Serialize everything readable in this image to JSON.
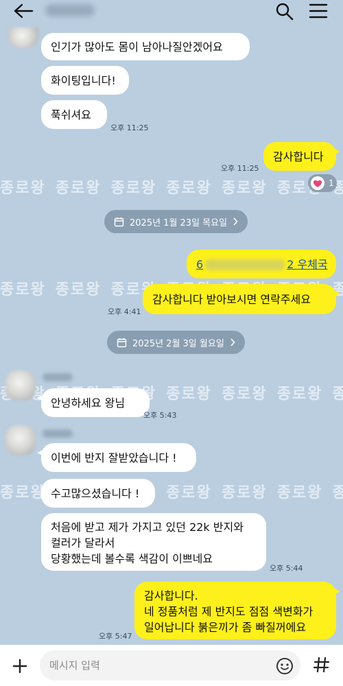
{
  "watermark": {
    "text": "종로왕",
    "repeat": [
      "종로왕",
      "종로왕",
      "종로왕",
      "종로왕",
      "종로왕",
      "종로왕",
      "종로왕"
    ]
  },
  "reaction": {
    "count": "1"
  },
  "messages": [
    {
      "text": "인기가 많아도 몸이 남아나질안겠어요"
    },
    {
      "text": "화이팅입니다!"
    },
    {
      "text": "푹쉬셔요",
      "time": "오후 11:25"
    },
    {
      "text": "감사합니다",
      "time": "오후 11:25"
    },
    {
      "link_prefix": "6",
      "link_suffix": "2 우체국"
    },
    {
      "text": "감사합니다 받아보시면 연락주세요",
      "time": "오후 4:41"
    },
    {
      "text": "안녕하세요 왕님",
      "time": "오후 5:43"
    },
    {
      "text": "이번에 반지 잘받았습니다 !"
    },
    {
      "text": "수고많으셨습니다 !"
    },
    {
      "text": "처음에 받고 제가 가지고 있던 22k 반지와\n컬러가 달라서\n당황했는데 볼수록 색감이 이쁘네요",
      "time": "오후 5:44"
    },
    {
      "text": "감사합니다.\n네 정품처럼 제 반지도 점점 색변화가\n일어납니다 붉은끼가 좀 빠질꺼에요",
      "time": "오후 5:47"
    }
  ],
  "dates": [
    {
      "label": "2025년 1월 23일 목요일"
    },
    {
      "label": "2025년 2월 3일 월요일"
    }
  ],
  "input": {
    "placeholder": "메시지 입력"
  },
  "colors": {
    "background": "#bacee0",
    "my_bubble": "#fef01b",
    "other_bubble": "#ffffff"
  }
}
